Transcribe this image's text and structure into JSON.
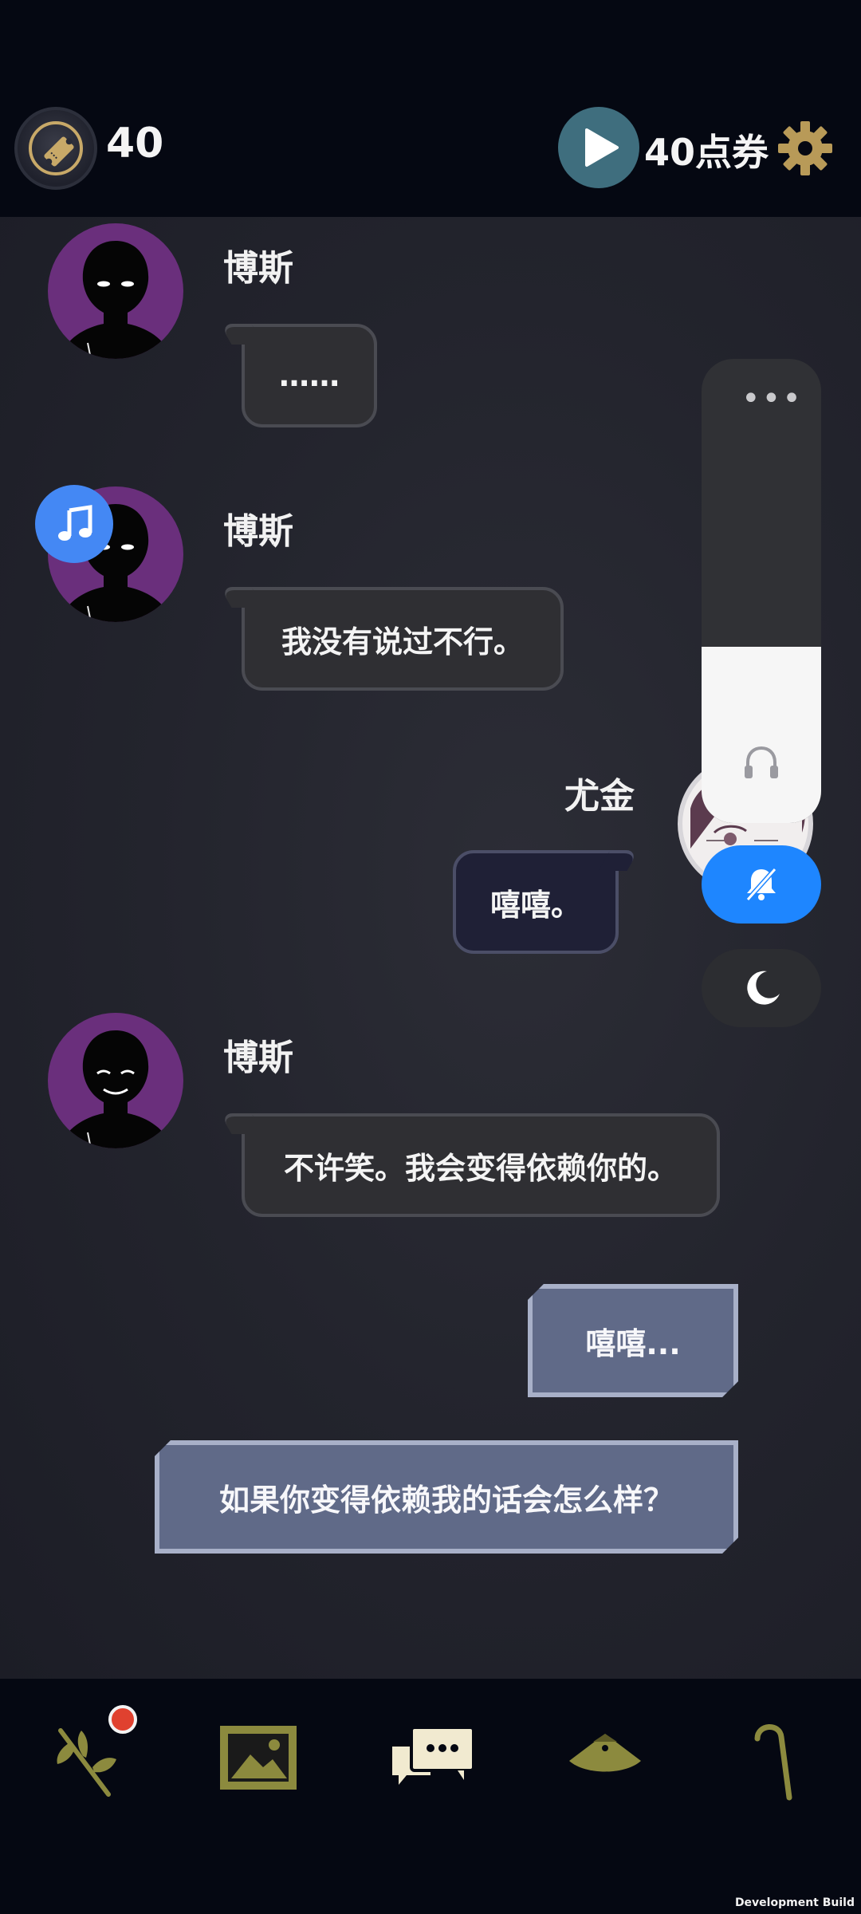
{
  "topbar": {
    "ticket_count": "40",
    "points_label": "40点券"
  },
  "messages": [
    {
      "speaker": "博斯",
      "text": "……",
      "side": "left"
    },
    {
      "speaker": "博斯",
      "text": "我没有说过不行。",
      "side": "left"
    },
    {
      "speaker": "尤金",
      "text": "嘻嘻。",
      "side": "right"
    },
    {
      "speaker": "博斯",
      "text": "不许笑。我会变得依赖你的。",
      "side": "left"
    }
  ],
  "choices": [
    {
      "label": "嘻嘻..."
    },
    {
      "label": "如果你变得依赖我的话会怎么样？"
    }
  ],
  "volume_panel": {
    "menu_label": "•••",
    "level_percent": 38
  },
  "bottom_nav": {
    "items": [
      {
        "icon": "flower-branch-icon",
        "has_badge": true
      },
      {
        "icon": "gallery-image-icon"
      },
      {
        "icon": "chat-bubbles-icon"
      },
      {
        "icon": "fan-hat-icon"
      },
      {
        "icon": "cane-icon"
      }
    ]
  },
  "colors": {
    "background": "#05080f",
    "chat_background": "#24252e",
    "left_bubble": "#2f2f33",
    "right_bubble": "#1f2036",
    "choice": "#606a88",
    "accent_blue": "#1e86ff",
    "gold": "#b89a58",
    "avatar_purple": "#6a2f7c"
  },
  "footer": {
    "dev_label": "Development Build"
  }
}
